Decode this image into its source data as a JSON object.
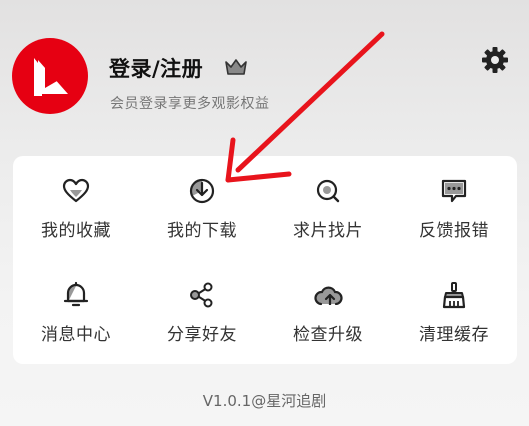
{
  "profile": {
    "title": "登录/注册",
    "subtitle": "会员登录享更多观影权益",
    "crown_icon": "crown-icon",
    "logo_color": "#e60012"
  },
  "settings": {
    "icon": "gear-icon"
  },
  "menu": {
    "items": [
      {
        "label": "我的收藏",
        "icon": "heart-icon"
      },
      {
        "label": "我的下载",
        "icon": "download-icon"
      },
      {
        "label": "求片找片",
        "icon": "search-icon"
      },
      {
        "label": "反馈报错",
        "icon": "feedback-icon"
      },
      {
        "label": "消息中心",
        "icon": "bell-icon"
      },
      {
        "label": "分享好友",
        "icon": "share-icon"
      },
      {
        "label": "检查升级",
        "icon": "upload-cloud-icon"
      },
      {
        "label": "清理缓存",
        "icon": "broom-icon"
      }
    ]
  },
  "footer": {
    "version": "V1.0.1@星河追剧"
  },
  "annotation": {
    "arrow_color": "#e8141c"
  }
}
